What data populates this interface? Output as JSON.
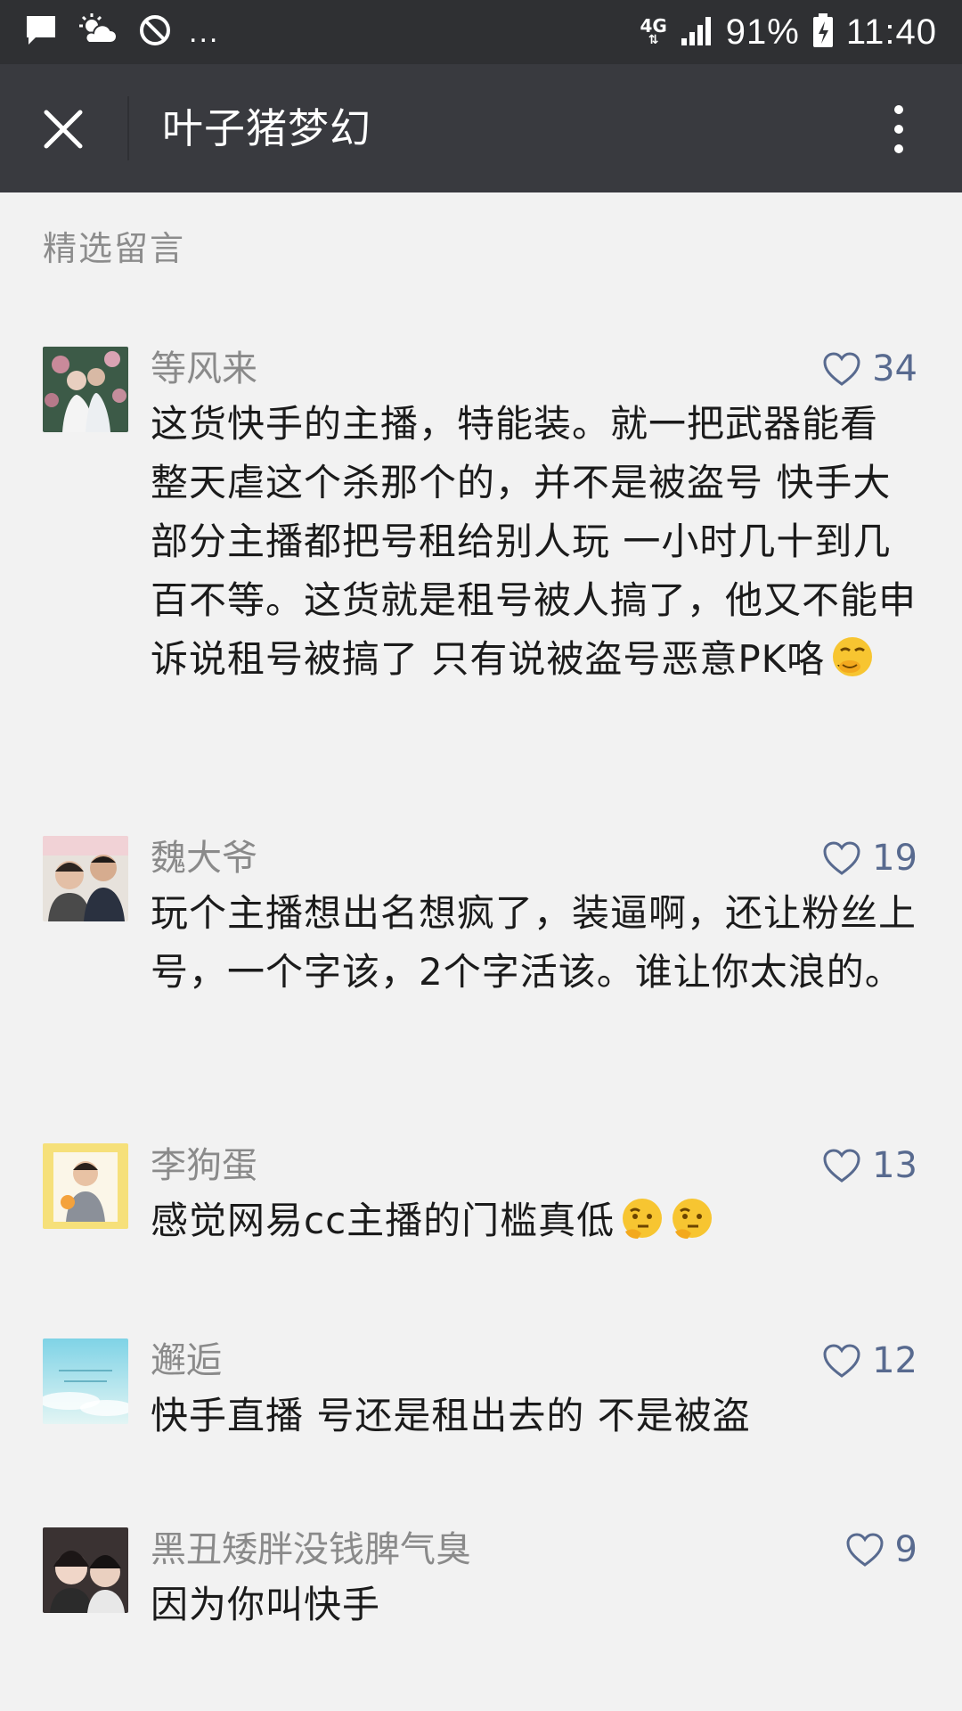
{
  "status_bar": {
    "network": "4G",
    "battery": "91%",
    "time": "11:40",
    "overflow": "..."
  },
  "header": {
    "title": "叶子猪梦幻"
  },
  "section": {
    "title": "精选留言"
  },
  "comments": [
    {
      "name": "等风来",
      "likes": "34",
      "text": "这货快手的主播，特能装。就一把武器能看 整天虐这个杀那个的，并不是被盗号 快手大部分主播都把号租给别人玩 一小时几十到几百不等。这货就是租号被人搞了，他又不能申诉说租号被搞了 只有说被盗号恶意PK咯"
    },
    {
      "name": "魏大爷",
      "likes": "19",
      "text": "玩个主播想出名想疯了，装逼啊，还让粉丝上号，一个字该，2个字活该。谁让你太浪的。"
    },
    {
      "name": "李狗蛋",
      "likes": "13",
      "text": "感觉网易cc主播的门槛真低"
    },
    {
      "name": "邂逅",
      "likes": "12",
      "text": "快手直播 号还是租出去的 不是被盗"
    },
    {
      "name": "黑丑矮胖没钱脾气臭",
      "likes": "9",
      "text": "因为你叫快手"
    }
  ],
  "colors": {
    "status_bar_bg": "#2f3033",
    "title_bar_bg": "#393a3f",
    "page_bg": "#f2f2f2",
    "like_color": "#586a8f"
  }
}
